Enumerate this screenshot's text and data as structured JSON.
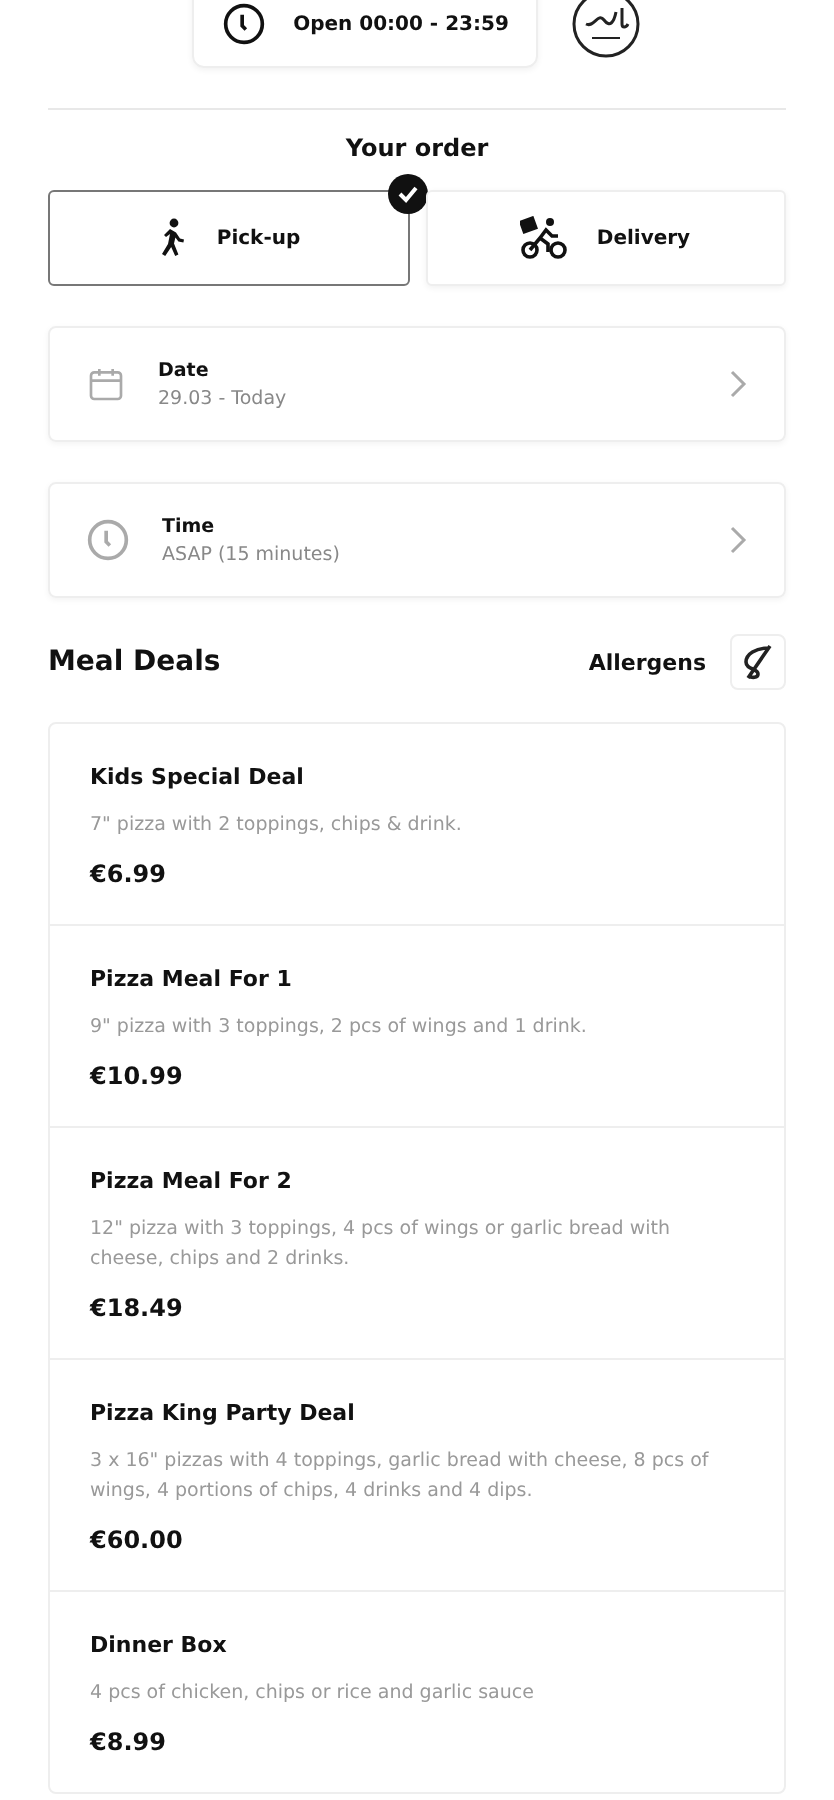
{
  "hours": {
    "label": "Open 00:00 - 23:59"
  },
  "order": {
    "title": "Your order",
    "modes": [
      {
        "kind": "pickup",
        "label": "Pick-up",
        "selected": true
      },
      {
        "kind": "delivery",
        "label": "Delivery",
        "selected": false
      }
    ],
    "pickers": [
      {
        "kind": "date",
        "label": "Date",
        "value": "29.03 - Today"
      },
      {
        "kind": "time",
        "label": "Time",
        "value": "ASAP (15 minutes)"
      }
    ]
  },
  "section": {
    "title": "Meal Deals",
    "allergens": "Allergens"
  },
  "deals": [
    {
      "name": "Kids Special Deal",
      "description": "7\" pizza with 2 toppings, chips & drink.",
      "price": "€6.99"
    },
    {
      "name": "Pizza Meal For 1",
      "description": "9\" pizza with 3 toppings, 2 pcs of wings and 1 drink.",
      "price": "€10.99"
    },
    {
      "name": "Pizza Meal For 2",
      "description": "12\" pizza with 3 toppings, 4 pcs of wings or garlic bread with cheese, chips and 2 drinks.",
      "price": "€18.49"
    },
    {
      "name": "Pizza King Party Deal",
      "description": "3 x 16\" pizzas with 4 toppings, garlic bread with cheese, 8 pcs of wings, 4 portions of chips, 4 drinks and 4 dips.",
      "price": "€60.00"
    },
    {
      "name": "Dinner Box",
      "description": "4 pcs of chicken, chips or rice and garlic sauce",
      "price": "€8.99"
    }
  ]
}
